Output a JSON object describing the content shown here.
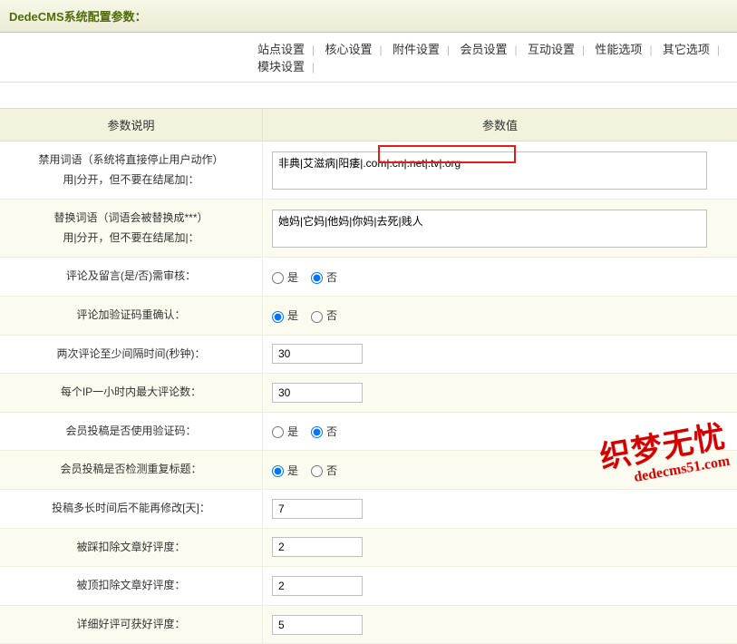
{
  "header": {
    "title": "DedeCMS系统配置参数："
  },
  "tabs": {
    "items": [
      "站点设置",
      "核心设置",
      "附件设置",
      "会员设置",
      "互动设置",
      "性能选项",
      "其它选项",
      "模块设置"
    ]
  },
  "columns": {
    "left": "参数说明",
    "right": "参数值"
  },
  "rows": {
    "r0": {
      "label1": "禁用词语（系统将直接停止用户动作）",
      "label2": "用|分开，但不要在结尾加|：",
      "value": "非典|艾滋病|阳痿|.com|.cn|.net|.tv|.org"
    },
    "r1": {
      "label1": "替换词语（词语会被替换成***）",
      "label2": "用|分开，但不要在结尾加|：",
      "value": "她妈|它妈|他妈|你妈|去死|贱人"
    },
    "r2": {
      "label": "评论及留言(是/否)需审核：",
      "yes": "是",
      "no": "否",
      "checked": "no"
    },
    "r3": {
      "label": "评论加验证码重确认：",
      "yes": "是",
      "no": "否",
      "checked": "yes"
    },
    "r4": {
      "label": "两次评论至少间隔时间(秒钟)：",
      "value": "30"
    },
    "r5": {
      "label": "每个IP一小时内最大评论数：",
      "value": "30"
    },
    "r6": {
      "label": "会员投稿是否使用验证码：",
      "yes": "是",
      "no": "否",
      "checked": "no"
    },
    "r7": {
      "label": "会员投稿是否检测重复标题：",
      "yes": "是",
      "no": "否",
      "checked": "yes"
    },
    "r8": {
      "label": "投稿多长时间后不能再修改[天]：",
      "value": "7"
    },
    "r9": {
      "label": "被踩扣除文章好评度：",
      "value": "2"
    },
    "r10": {
      "label": "被顶扣除文章好评度：",
      "value": "2"
    },
    "r11": {
      "label": "详细好评可获好评度：",
      "value": "5"
    }
  },
  "watermark": {
    "main": "织梦无忧",
    "sub": "dedecms51.com"
  }
}
